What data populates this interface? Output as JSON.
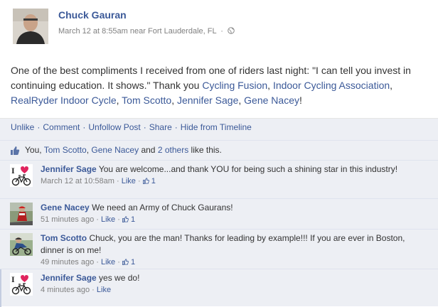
{
  "post": {
    "author": "Chuck Gauran",
    "timestamp": "March 12 at 8:55am",
    "location": "near Fort Lauderdale, FL",
    "text_1": "One of the best compliments I received from one of riders last night: \"I can tell you invest in continuing education. It shows.\" Thank you ",
    "tags": [
      "Cycling Fusion",
      "Indoor Cycling Association",
      "RealRyder Indoor Cycle",
      "Tom Scotto",
      "Jennifer Sage",
      "Gene Nacey"
    ],
    "text_end": "!"
  },
  "actions": [
    "Unlike",
    "Comment",
    "Unfollow Post",
    "Share",
    "Hide from Timeline"
  ],
  "likes": {
    "you": "You",
    "people": [
      "Tom Scotto",
      "Gene Nacey"
    ],
    "and": "and",
    "others": "2 others",
    "suffix": "like this."
  },
  "comments": [
    {
      "name": "Jennifer Sage",
      "text": "You are welcome...and thank YOU for being such a shining star in this industry!",
      "time": "March 12 at 10:58am",
      "like": "Like",
      "like_count": "1",
      "avatar": "i-heart-bike"
    },
    {
      "name": "Gene Nacey",
      "text": "We need an Army of Chuck Gaurans!",
      "time": "51 minutes ago",
      "like": "Like",
      "like_count": "1",
      "avatar": "cyclist-photo"
    },
    {
      "name": "Tom Scotto",
      "text": "Chuck, you are the man! Thanks for leading by example!!! If you are ever in Boston, dinner is on me!",
      "time": "49 minutes ago",
      "like": "Like",
      "like_count": "1",
      "avatar": "cyclist-photo"
    },
    {
      "name": "Jennifer Sage",
      "text": "yes we do!",
      "time": "4 minutes ago",
      "like": "Like",
      "like_count": "",
      "avatar": "i-heart-bike"
    }
  ],
  "colors": {
    "link": "#3b5998",
    "feedback_bg": "#edeff4",
    "meta": "#808080",
    "heart": "#e0245e"
  }
}
